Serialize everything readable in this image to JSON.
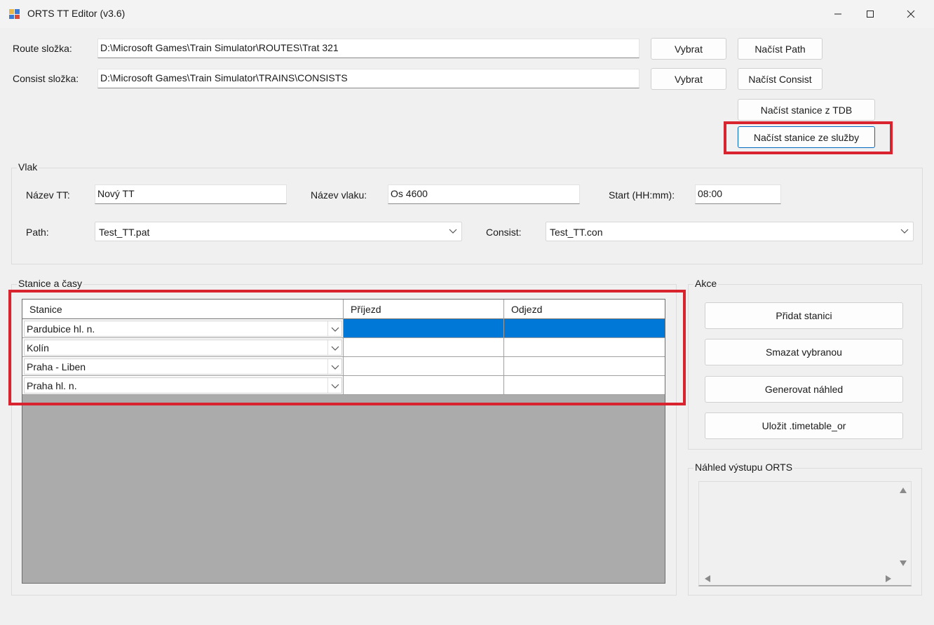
{
  "window": {
    "title": "ORTS TT Editor (v3.6)",
    "controls": {
      "minimize": "—",
      "maximize": "☐",
      "close": "✕"
    }
  },
  "folders": {
    "route_label": "Route složka:",
    "route_value": "D:\\Microsoft Games\\Train Simulator\\ROUTES\\Trat 321",
    "consist_label": "Consist složka:",
    "consist_value": "D:\\Microsoft Games\\Train Simulator\\TRAINS\\CONSISTS",
    "select_button": "Vybrat",
    "load_path_button": "Načíst Path",
    "load_consist_button": "Načíst Consist",
    "load_tdb_button": "Načíst stanice z TDB",
    "load_service_button": "Načíst stanice ze služby"
  },
  "train": {
    "group_title": "Vlak",
    "tt_name_label": "Název TT:",
    "tt_name_value": "Nový TT",
    "train_name_label": "Název vlaku:",
    "train_name_value": "Os 4600",
    "start_label": "Start (HH:mm):",
    "start_value": "08:00",
    "path_label": "Path:",
    "path_value": "Test_TT.pat",
    "consist_label": "Consist:",
    "consist_value": "Test_TT.con"
  },
  "stations": {
    "group_title": "Stanice a časy",
    "columns": [
      "Stanice",
      "Příjezd",
      "Odjezd"
    ],
    "rows": [
      {
        "station": "Pardubice hl. n.",
        "arrival": "",
        "departure": ""
      },
      {
        "station": "Kolín",
        "arrival": "",
        "departure": ""
      },
      {
        "station": "Praha - Liben",
        "arrival": "",
        "departure": ""
      },
      {
        "station": "Praha hl. n.",
        "arrival": "",
        "departure": ""
      }
    ],
    "selected_row": 0
  },
  "actions": {
    "group_title": "Akce",
    "add_station": "Přidat stanici",
    "delete_selected": "Smazat vybranou",
    "generate_preview": "Generovat náhled",
    "save_timetable": "Uložit .timetable_or"
  },
  "preview": {
    "group_title": "Náhled výstupu ORTS",
    "text": ""
  },
  "colors": {
    "highlight": "#d9232e",
    "selection": "#0078d7",
    "grid_background": "#ababab"
  }
}
